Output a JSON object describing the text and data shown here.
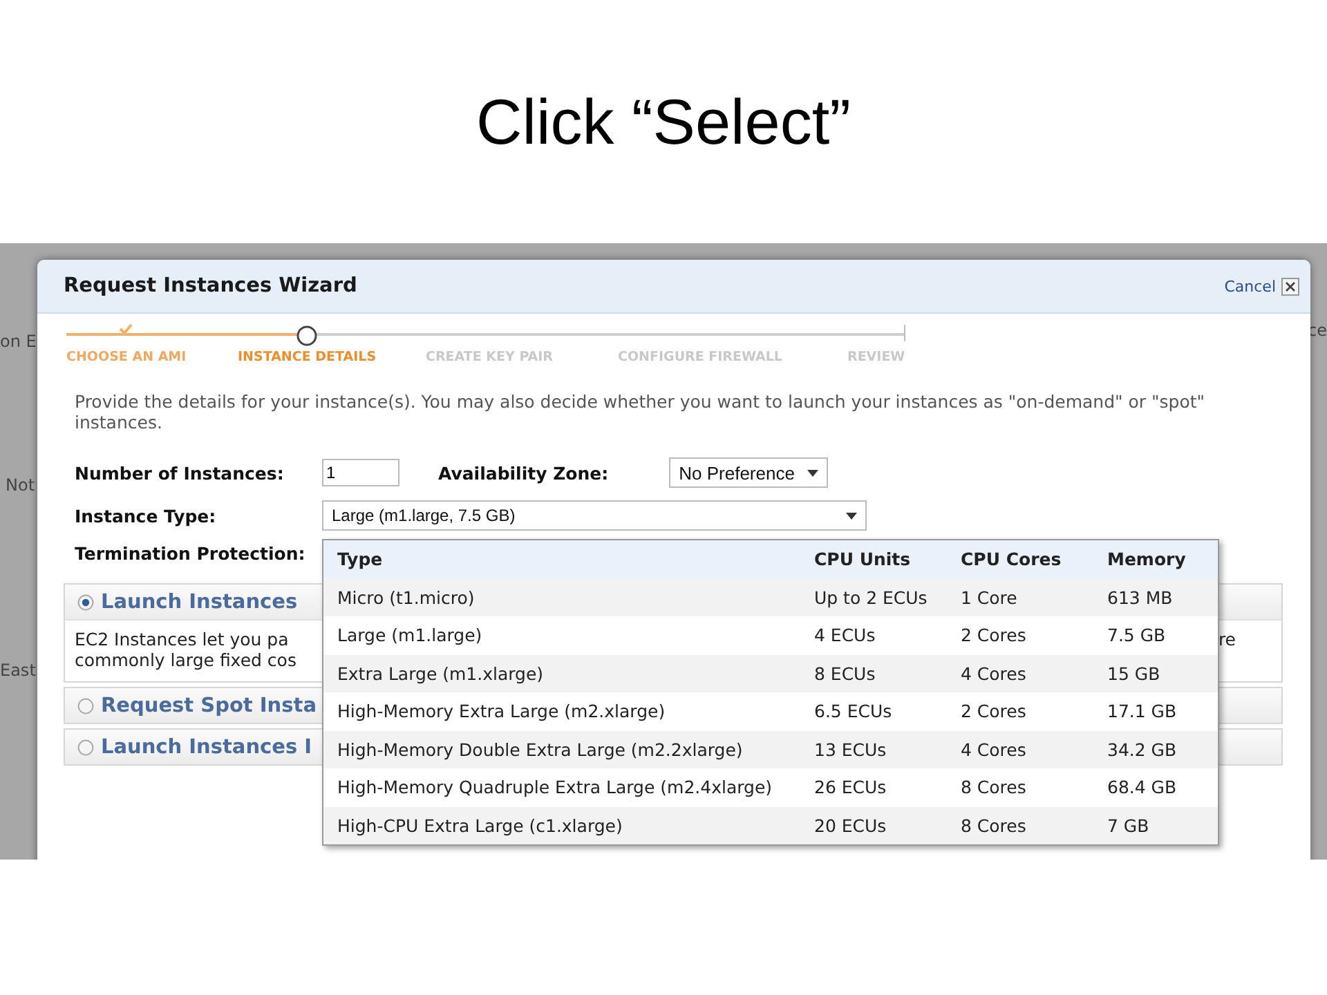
{
  "slide": {
    "title": "Click “Select”"
  },
  "background_text": [
    "on E",
    "Not",
    "East",
    "ce"
  ],
  "dialog": {
    "title": "Request Instances Wizard",
    "cancel": "Cancel",
    "steps": [
      {
        "label": "CHOOSE AN AMI",
        "done": true,
        "selected": false
      },
      {
        "label": "INSTANCE DETAILS",
        "done": false,
        "selected": true
      },
      {
        "label": "CREATE KEY PAIR",
        "done": false,
        "selected": false
      },
      {
        "label": "CONFIGURE FIREWALL",
        "done": false,
        "selected": false
      },
      {
        "label": "REVIEW",
        "done": false,
        "selected": false
      }
    ],
    "intro": "Provide the details for your instance(s). You may also decide whether you want to launch your instances as \"on-demand\" or \"spot\" instances.",
    "fields": {
      "instances_label": "Number of Instances:",
      "instances_value": "1",
      "zone_label": "Availability Zone:",
      "zone_value": "No Preference",
      "type_label": "Instance Type:",
      "type_value": "Large (m1.large, 7.5 GB)",
      "termination_label": "Termination Protection:"
    },
    "sections": [
      {
        "title": "Launch Instances",
        "selected": true,
        "text_lines": [
          "EC2 Instances let you pa",
          "commonly large fixed cos"
        ],
        "text_right": "re"
      },
      {
        "title": "Request Spot Insta",
        "selected": false
      },
      {
        "title": "Launch Instances I",
        "selected": false
      }
    ],
    "type_list": {
      "columns": [
        "Type",
        "CPU Units",
        "CPU Cores",
        "Memory"
      ],
      "rows": [
        [
          "Micro (t1.micro)",
          "Up to 2 ECUs",
          "1 Core",
          "613 MB"
        ],
        [
          "Large (m1.large)",
          "4 ECUs",
          "2 Cores",
          "7.5 GB"
        ],
        [
          "Extra Large (m1.xlarge)",
          "8 ECUs",
          "4 Cores",
          "15 GB"
        ],
        [
          "High-Memory Extra Large (m2.xlarge)",
          "6.5 ECUs",
          "2 Cores",
          "17.1 GB"
        ],
        [
          "High-Memory Double Extra Large (m2.2xlarge)",
          "13 ECUs",
          "4 Cores",
          "34.2 GB"
        ],
        [
          "High-Memory Quadruple Extra Large (m2.4xlarge)",
          "26 ECUs",
          "8 Cores",
          "68.4 GB"
        ],
        [
          "High-CPU Extra Large (c1.xlarge)",
          "20 ECUs",
          "8 Cores",
          "7 GB"
        ]
      ]
    }
  }
}
